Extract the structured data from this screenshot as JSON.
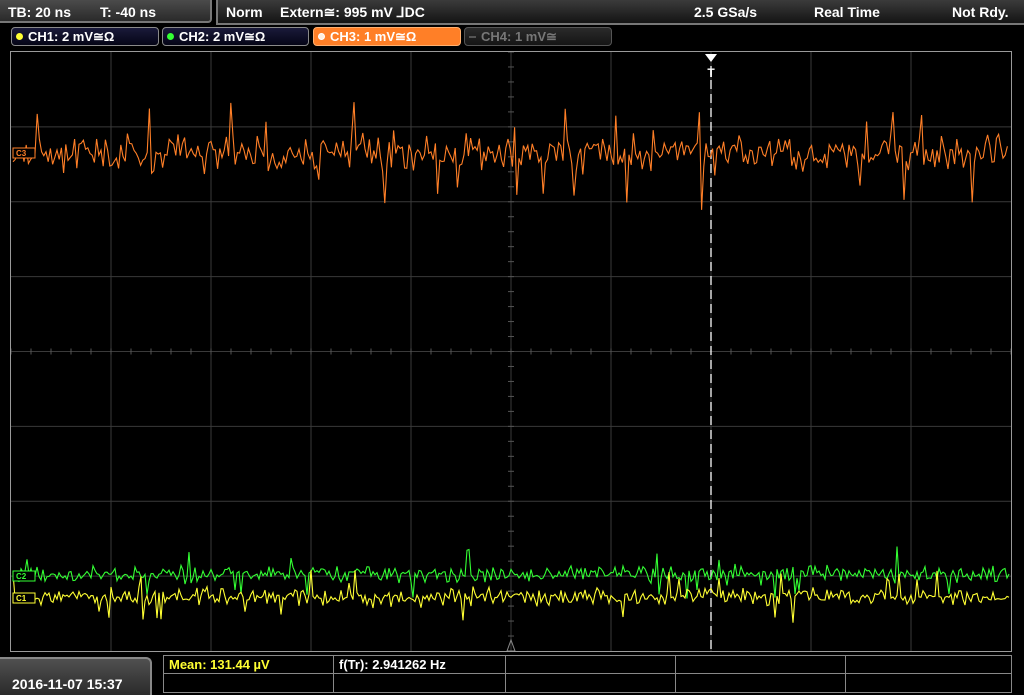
{
  "timebase": {
    "tb_label": "TB: 20 ns",
    "t_label": "T: -40 ns"
  },
  "status": {
    "trigger_mode": "Norm",
    "trigger_source": "Extern≅: 995 mV ⅃DC",
    "sample_rate": "2.5 GSa/s",
    "acq_mode": "Real Time",
    "state": "Not Rdy."
  },
  "channels": [
    {
      "label": "CH1: 2 mV≅Ω",
      "color": "#ffff33",
      "active": false,
      "enabled": true
    },
    {
      "label": "CH2: 2 mV≅Ω",
      "color": "#33ff33",
      "active": false,
      "enabled": true
    },
    {
      "label": "CH3: 1 mV≅Ω",
      "color": "#ff7f27",
      "active": true,
      "enabled": true
    },
    {
      "label": "CH4: 1 mV≅",
      "color": "#777777",
      "active": false,
      "enabled": false
    }
  ],
  "markers": {
    "trigger_marker": "T",
    "ch3_marker": "C3",
    "ch2_marker": "C2",
    "ch1_marker": "C1"
  },
  "measurements": {
    "mean": "Mean: 131.44 µV",
    "freq": "f(Tr): 2.941262 Hz"
  },
  "datetime": "2016-11-07 15:37",
  "colors": {
    "ch1": "#ffff33",
    "ch2": "#33ff33",
    "ch3": "#ff7f27",
    "grid": "#3a3a3a"
  }
}
